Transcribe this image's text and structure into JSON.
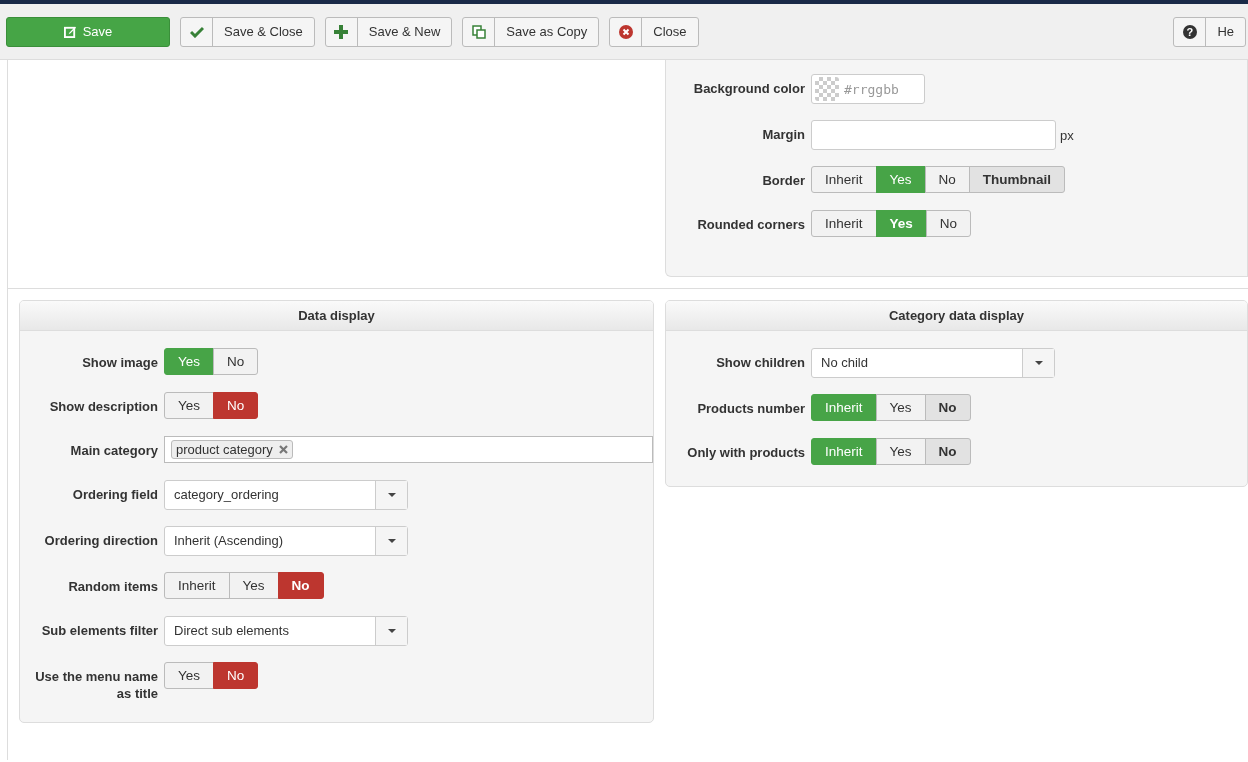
{
  "toolbar": {
    "buttons": [
      {
        "kind": "primary",
        "label": "Save"
      },
      {
        "kind": "split",
        "label": "Save & Close"
      },
      {
        "kind": "split",
        "label": "Save & New"
      },
      {
        "kind": "split",
        "label": "Save as Copy"
      },
      {
        "kind": "split",
        "label": "Close"
      }
    ],
    "help": {
      "symbol": "?",
      "label": "He"
    }
  },
  "image_options": {
    "fields": [
      {
        "kind": "color",
        "label": "Background color",
        "placeholder": "#rrggbb"
      },
      {
        "kind": "text",
        "label": "Margin",
        "unit": "px"
      },
      {
        "kind": "radio",
        "label": "Border",
        "options": [
          {
            "label": "Inherit",
            "selected": false,
            "default": false
          },
          {
            "label": "Yes",
            "selected": true,
            "default": false,
            "color": "#47a447"
          },
          {
            "label": "No",
            "selected": false,
            "default": false
          },
          {
            "label": "Thumbnail",
            "selected": false,
            "default": true
          }
        ]
      },
      {
        "kind": "radio",
        "label": "Rounded corners",
        "options": [
          {
            "label": "Inherit",
            "selected": false,
            "default": false
          },
          {
            "label": "Yes",
            "selected": true,
            "default": true,
            "color": "#47a447"
          },
          {
            "label": "No",
            "selected": false,
            "default": false
          }
        ]
      }
    ]
  },
  "panels": [
    {
      "title": "Data display",
      "fields": [
        {
          "kind": "radio",
          "label": "Show image",
          "options": [
            {
              "label": "Yes",
              "selected": true,
              "default": false,
              "color": "#47a447"
            },
            {
              "label": "No",
              "selected": false,
              "default": false
            }
          ]
        },
        {
          "kind": "radio",
          "label": "Show description",
          "options": [
            {
              "label": "Yes",
              "selected": false,
              "default": false
            },
            {
              "label": "No",
              "selected": true,
              "default": false,
              "color": "#bd362f"
            }
          ]
        },
        {
          "kind": "tags",
          "label": "Main category",
          "tags": [
            "product category"
          ]
        },
        {
          "kind": "select",
          "label": "Ordering field",
          "value": "category_ordering"
        },
        {
          "kind": "select",
          "label": "Ordering direction",
          "value": "Inherit (Ascending)"
        },
        {
          "kind": "radio",
          "label": "Random items",
          "options": [
            {
              "label": "Inherit",
              "selected": false,
              "default": false
            },
            {
              "label": "Yes",
              "selected": false,
              "default": false
            },
            {
              "label": "No",
              "selected": true,
              "default": true,
              "color": "#bd362f"
            }
          ]
        },
        {
          "kind": "select",
          "label": "Sub elements filter",
          "value": "Direct sub elements"
        },
        {
          "kind": "radio",
          "label": "Use the menu name as title",
          "options": [
            {
              "label": "Yes",
              "selected": false,
              "default": false
            },
            {
              "label": "No",
              "selected": true,
              "default": false,
              "color": "#bd362f"
            }
          ]
        }
      ]
    },
    {
      "title": "Category data display",
      "fields": [
        {
          "kind": "select",
          "label": "Show children",
          "value": "No child"
        },
        {
          "kind": "radio",
          "label": "Products number",
          "options": [
            {
              "label": "Inherit",
              "selected": true,
              "default": false,
              "color": "#47a447"
            },
            {
              "label": "Yes",
              "selected": false,
              "default": false
            },
            {
              "label": "No",
              "selected": false,
              "default": true
            }
          ]
        },
        {
          "kind": "radio",
          "label": "Only with products",
          "options": [
            {
              "label": "Inherit",
              "selected": true,
              "default": false,
              "color": "#47a447"
            },
            {
              "label": "Yes",
              "selected": false,
              "default": false
            },
            {
              "label": "No",
              "selected": false,
              "default": true
            }
          ]
        }
      ]
    }
  ]
}
